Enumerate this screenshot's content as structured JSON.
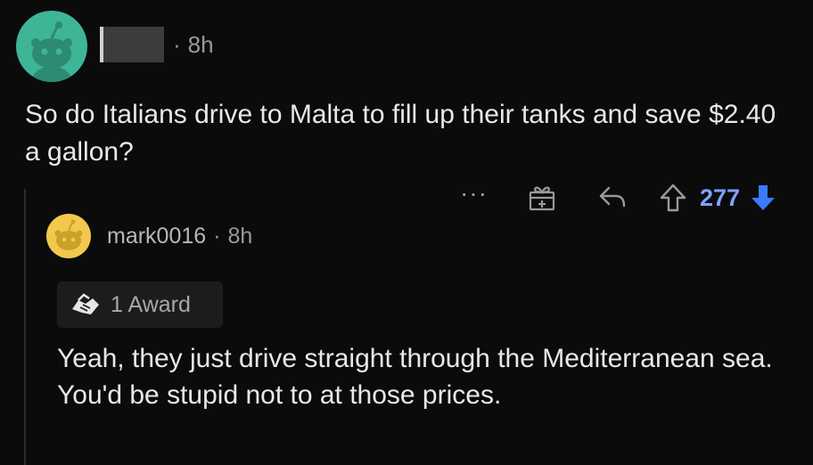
{
  "parent_comment": {
    "time": "8h",
    "separator": "·",
    "body": "So do Italians drive to Malta to fill up their tanks and save $2.40 a gallon?",
    "avatar_color": "#3fb598"
  },
  "actions": {
    "more_label": "···",
    "vote_count": "277",
    "vote_color": "#7ea3ff",
    "icons": [
      "gift-icon",
      "reply-icon",
      "upvote-icon",
      "downvote-icon"
    ]
  },
  "reply": {
    "author": "mark0016",
    "separator": "·",
    "time": "8h",
    "award_label": "1 Award",
    "body": "Yeah, they just drive straight through the Mediterranean sea. You'd be stupid not to at those prices.",
    "avatar_color": "#f2c94c"
  }
}
